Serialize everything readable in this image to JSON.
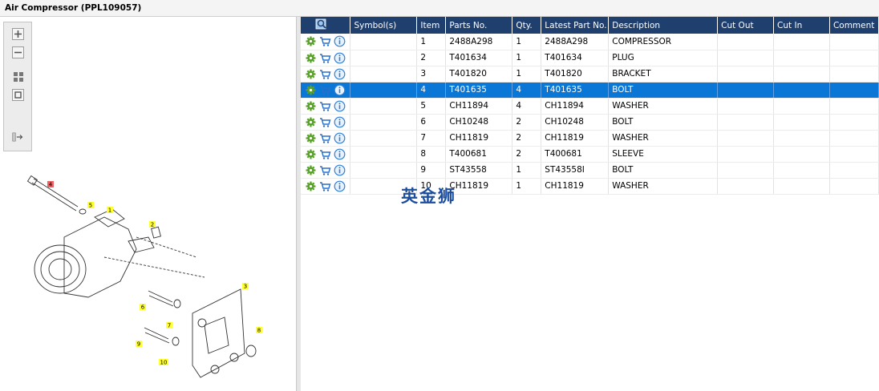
{
  "window": {
    "title": "Air Compressor (PPL109057)"
  },
  "toolbar": {
    "buttons": [
      {
        "name": "zoom-in-icon"
      },
      {
        "name": "zoom-out-icon"
      },
      {
        "name": "fit-grid-icon"
      },
      {
        "name": "fit-window-icon"
      },
      {
        "name": "export-list-icon"
      }
    ]
  },
  "diagram": {
    "callouts": [
      "4",
      "5",
      "1",
      "2",
      "3",
      "6",
      "7",
      "8",
      "9",
      "10"
    ],
    "colors": {
      "callout_fill": "#ffff33",
      "callout_highlight": "#ef6060"
    }
  },
  "table": {
    "columns": [
      "",
      "Symbol(s)",
      "Item",
      "Parts No.",
      "Qty.",
      "Latest Part No.",
      "Description",
      "Cut Out",
      "Cut In",
      "Comment"
    ],
    "rows": [
      {
        "symbols": "",
        "item": "1",
        "part_no": "2488A298",
        "qty": "1",
        "latest": "2488A298",
        "desc": "COMPRESSOR",
        "cut_out": "",
        "cut_in": "",
        "comment": ""
      },
      {
        "symbols": "",
        "item": "2",
        "part_no": "T401634",
        "qty": "1",
        "latest": "T401634",
        "desc": "PLUG",
        "cut_out": "",
        "cut_in": "",
        "comment": ""
      },
      {
        "symbols": "",
        "item": "3",
        "part_no": "T401820",
        "qty": "1",
        "latest": "T401820",
        "desc": "BRACKET",
        "cut_out": "",
        "cut_in": "",
        "comment": ""
      },
      {
        "symbols": "",
        "item": "4",
        "part_no": "T401635",
        "qty": "4",
        "latest": "T401635",
        "desc": "BOLT",
        "cut_out": "",
        "cut_in": "",
        "comment": ""
      },
      {
        "symbols": "",
        "item": "5",
        "part_no": "CH11894",
        "qty": "4",
        "latest": "CH11894",
        "desc": "WASHER",
        "cut_out": "",
        "cut_in": "",
        "comment": ""
      },
      {
        "symbols": "",
        "item": "6",
        "part_no": "CH10248",
        "qty": "2",
        "latest": "CH10248",
        "desc": "BOLT",
        "cut_out": "",
        "cut_in": "",
        "comment": ""
      },
      {
        "symbols": "",
        "item": "7",
        "part_no": "CH11819",
        "qty": "2",
        "latest": "CH11819",
        "desc": "WASHER",
        "cut_out": "",
        "cut_in": "",
        "comment": ""
      },
      {
        "symbols": "",
        "item": "8",
        "part_no": "T400681",
        "qty": "2",
        "latest": "T400681",
        "desc": "SLEEVE",
        "cut_out": "",
        "cut_in": "",
        "comment": ""
      },
      {
        "symbols": "",
        "item": "9",
        "part_no": "ST43558",
        "qty": "1",
        "latest": "ST43558I",
        "desc": "BOLT",
        "cut_out": "",
        "cut_in": "",
        "comment": ""
      },
      {
        "symbols": "",
        "item": "10",
        "part_no": "CH11819",
        "qty": "1",
        "latest": "CH11819",
        "desc": "WASHER",
        "cut_out": "",
        "cut_in": "",
        "comment": ""
      }
    ],
    "selected_row": 3,
    "row_icons": [
      "settings-gear-icon",
      "add-to-cart-icon",
      "info-icon"
    ],
    "colors": {
      "header_bg": "#1f3f6e",
      "selected_bg": "#0a77d6",
      "gear": "#5aa02c",
      "cart": "#2a6fc9",
      "info": "#2f7fd8"
    }
  },
  "watermark": {
    "text": "英金狮"
  }
}
